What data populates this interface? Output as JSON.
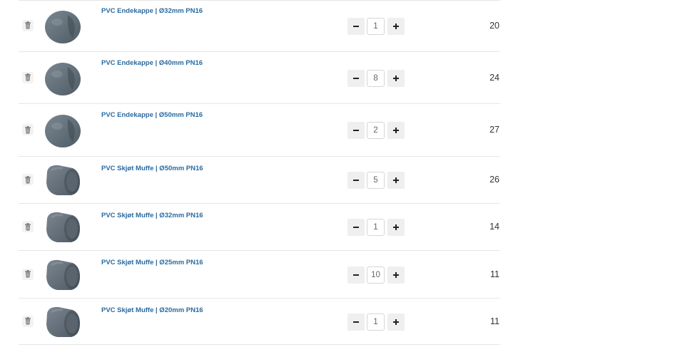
{
  "colors": {
    "link": "#2a6aa0",
    "divider": "#e6e6e6",
    "button_bg": "#efefef"
  },
  "cart": {
    "items": [
      {
        "name": "PVC Endekappe | Ø32mm PN16",
        "qty": "1",
        "price": "20",
        "image": "end-cap-image"
      },
      {
        "name": "PVC Endekappe | Ø40mm PN16",
        "qty": "8",
        "price": "24",
        "image": "end-cap-image"
      },
      {
        "name": "PVC Endekappe | Ø50mm PN16",
        "qty": "2",
        "price": "27",
        "image": "end-cap-image"
      },
      {
        "name": "PVC Skjøt Muffe | Ø50mm PN16",
        "qty": "5",
        "price": "26",
        "image": "coupling-sleeve-image"
      },
      {
        "name": "PVC Skjøt Muffe | Ø32mm PN16",
        "qty": "1",
        "price": "14",
        "image": "coupling-sleeve-image"
      },
      {
        "name": "PVC Skjøt Muffe | Ø25mm PN16",
        "qty": "10",
        "price": "11",
        "image": "coupling-sleeve-image"
      },
      {
        "name": "PVC Skjøt Muffe | Ø20mm PN16",
        "qty": "1",
        "price": "11",
        "image": "coupling-sleeve-image"
      }
    ]
  }
}
